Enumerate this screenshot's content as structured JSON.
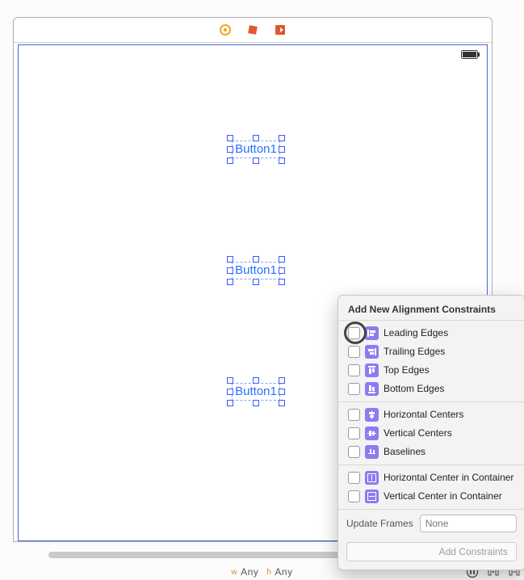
{
  "canvas": {
    "buttons": [
      "Button1",
      "Button1",
      "Button1"
    ]
  },
  "sizeclass": {
    "w_prefix": "w",
    "w": "Any",
    "h_prefix": "h",
    "h": "Any"
  },
  "popover": {
    "title": "Add New Alignment Constraints",
    "groups": [
      [
        "Leading Edges",
        "Trailing Edges",
        "Top Edges",
        "Bottom Edges"
      ],
      [
        "Horizontal Centers",
        "Vertical Centers",
        "Baselines"
      ],
      [
        "Horizontal Center in Container",
        "Vertical Center in Container"
      ]
    ],
    "update_label": "Update Frames",
    "update_value": "None",
    "add_label": "Add Constraints"
  }
}
